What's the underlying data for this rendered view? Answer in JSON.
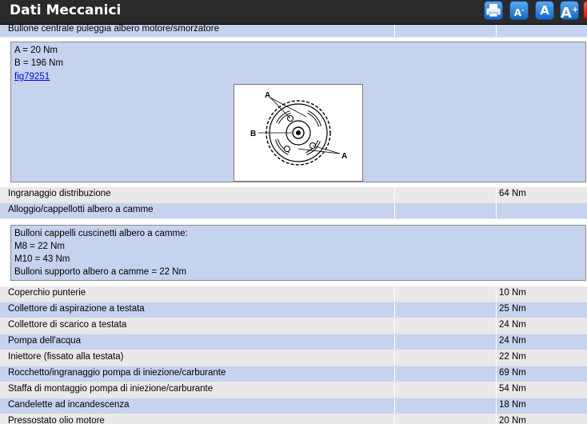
{
  "header": {
    "title": "Dati Meccanici",
    "buttons": [
      {
        "name": "print-button",
        "icon": "printer-icon"
      },
      {
        "name": "font-smaller-button",
        "label": "A",
        "sup": "-"
      },
      {
        "name": "font-normal-button",
        "label": "A"
      },
      {
        "name": "font-larger-button",
        "label": "A",
        "sup": "+"
      },
      {
        "name": "close-button",
        "icon": "close-icon"
      }
    ]
  },
  "rows_top": {
    "r0": {
      "label": "Bullone centrale puleggia albero motore/smorzatore",
      "value": ""
    },
    "r1": {
      "label": "Ingranaggio distribuzione",
      "value": "64 Nm"
    },
    "r2": {
      "label": "Alloggio/cappellotti albero a camme",
      "value": ""
    }
  },
  "panel1": {
    "line1": "A = 20 Nm",
    "line2": "B = 196 Nm",
    "link": "fig79251",
    "figure": {
      "label_a": "A",
      "label_b": "B",
      "label_a2": "A"
    }
  },
  "panel2": {
    "line1": "Bulloni cappelli cuscinetti albero a camme:",
    "line2": "M8 = 22 Nm",
    "line3": "M10 = 43 Nm",
    "line4": "Bulloni supporto albero a camme = 22 Nm"
  },
  "rows": [
    {
      "label": "Coperchio punterie",
      "value": "10 Nm"
    },
    {
      "label": "Collettore di aspirazione a testata",
      "value": "25 Nm"
    },
    {
      "label": "Collettore di scarico a testata",
      "value": "24 Nm"
    },
    {
      "label": "Pompa dell'acqua",
      "value": "24 Nm"
    },
    {
      "label": "Iniettore (fissato alla testata)",
      "value": "22 Nm"
    },
    {
      "label": "Rocchetto/ingranaggio pompa di iniezione/carburante",
      "value": "69 Nm"
    },
    {
      "label": "Staffa di montaggio pompa di iniezione/carburante",
      "value": "54 Nm"
    },
    {
      "label": "Candelette ad incandescenza",
      "value": "18 Nm"
    },
    {
      "label": "Pressostato olio motore",
      "value": "20 Nm"
    }
  ]
}
